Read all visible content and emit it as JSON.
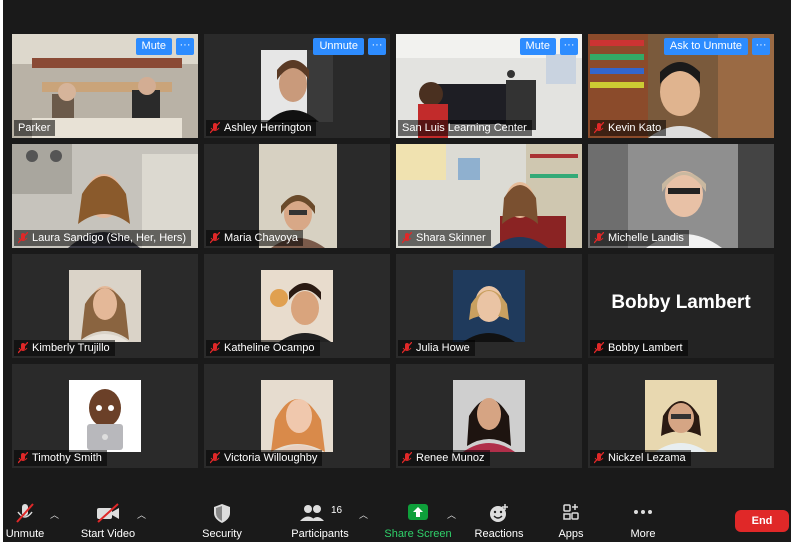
{
  "tiles": [
    {
      "name": "Parker"
    },
    {
      "name": "Ashley Herrington",
      "button": "Unmute"
    },
    {
      "name": "San Luis Learning Center",
      "button": "Mute"
    },
    {
      "name": "Kevin Kato",
      "button": "Ask to Unmute"
    },
    {
      "name": "Laura Sandigo (She, Her, Hers)"
    },
    {
      "name": "Maria Chavoya"
    },
    {
      "name": "Shara Skinner"
    },
    {
      "name": "Michelle Landis"
    },
    {
      "name": "Kimberly Trujillo"
    },
    {
      "name": "Katheline Ocampo"
    },
    {
      "name": "Julia Howe"
    },
    {
      "name": "Bobby Lambert",
      "big_name": "Bobby Lambert"
    },
    {
      "name": "Timothy Smith"
    },
    {
      "name": "Victoria Willoughby"
    },
    {
      "name": "Renee Munoz"
    },
    {
      "name": "Nickzel Lezama"
    }
  ],
  "parker_button": "Mute",
  "more_glyph": "···",
  "toolbar": {
    "unmute": "Unmute",
    "start_video": "Start Video",
    "security": "Security",
    "participants": "Participants",
    "participants_count": "16",
    "share_screen": "Share Screen",
    "reactions": "Reactions",
    "apps": "Apps",
    "more": "More",
    "end": "End"
  },
  "colors": {
    "accent": "#2d8cff",
    "active_speaker": "#c5e04a",
    "share": "#0e9f3a",
    "end": "#e02828",
    "muted": "#e02828"
  }
}
